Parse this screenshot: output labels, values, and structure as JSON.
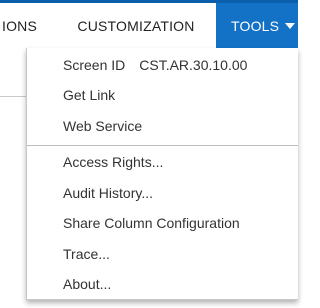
{
  "menubar": {
    "items": [
      {
        "label": "IONS"
      },
      {
        "label": "CUSTOMIZATION"
      },
      {
        "label": "TOOLS"
      }
    ]
  },
  "dropdown": {
    "screen_id_label": "Screen ID",
    "screen_id_value": "CST.AR.30.10.00",
    "items": [
      {
        "label": "Get Link"
      },
      {
        "label": "Web Service"
      },
      {
        "label": "Access Rights..."
      },
      {
        "label": "Audit History..."
      },
      {
        "label": "Share Column Configuration"
      },
      {
        "label": "Trace..."
      },
      {
        "label": "About..."
      }
    ]
  },
  "colors": {
    "accent": "#1371c6",
    "top_line": "#0b5faa"
  }
}
